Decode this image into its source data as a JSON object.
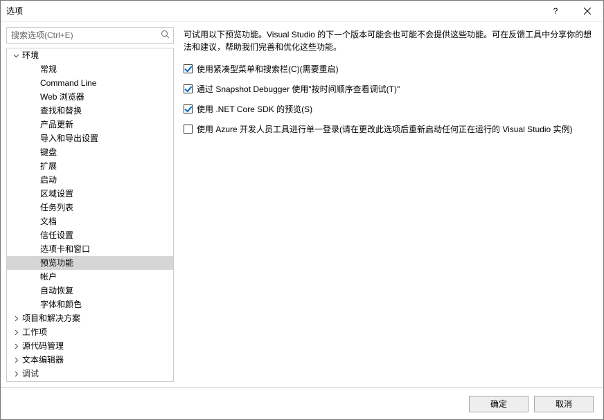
{
  "window": {
    "title": "选项"
  },
  "search": {
    "placeholder": "搜索选项(Ctrl+E)"
  },
  "tree": {
    "items": [
      {
        "label": "环境",
        "level": 0,
        "expanded": true,
        "hasChildren": true,
        "selected": false
      },
      {
        "label": "常规",
        "level": 1,
        "selected": false
      },
      {
        "label": "Command Line",
        "level": 1,
        "selected": false
      },
      {
        "label": "Web 浏览器",
        "level": 1,
        "selected": false
      },
      {
        "label": "查找和替换",
        "level": 1,
        "selected": false
      },
      {
        "label": "产品更新",
        "level": 1,
        "selected": false
      },
      {
        "label": "导入和导出设置",
        "level": 1,
        "selected": false
      },
      {
        "label": "键盘",
        "level": 1,
        "selected": false
      },
      {
        "label": "扩展",
        "level": 1,
        "selected": false
      },
      {
        "label": "启动",
        "level": 1,
        "selected": false
      },
      {
        "label": "区域设置",
        "level": 1,
        "selected": false
      },
      {
        "label": "任务列表",
        "level": 1,
        "selected": false
      },
      {
        "label": "文档",
        "level": 1,
        "selected": false
      },
      {
        "label": "信任设置",
        "level": 1,
        "selected": false
      },
      {
        "label": "选项卡和窗口",
        "level": 1,
        "selected": false
      },
      {
        "label": "预览功能",
        "level": 1,
        "selected": true
      },
      {
        "label": "帐户",
        "level": 1,
        "selected": false
      },
      {
        "label": "自动恢复",
        "level": 1,
        "selected": false
      },
      {
        "label": "字体和颜色",
        "level": 1,
        "selected": false
      },
      {
        "label": "项目和解决方案",
        "level": 0,
        "expanded": false,
        "hasChildren": true,
        "selected": false
      },
      {
        "label": "工作项",
        "level": 0,
        "expanded": false,
        "hasChildren": true,
        "selected": false
      },
      {
        "label": "源代码管理",
        "level": 0,
        "expanded": false,
        "hasChildren": true,
        "selected": false
      },
      {
        "label": "文本编辑器",
        "level": 0,
        "expanded": false,
        "hasChildren": true,
        "selected": false
      },
      {
        "label": "调试",
        "level": 0,
        "expanded": false,
        "hasChildren": true,
        "selected": false,
        "cut": true
      }
    ]
  },
  "main": {
    "description": "可试用以下预览功能。Visual Studio 的下一个版本可能会也可能不会提供这些功能。可在反馈工具中分享你的想法和建议，帮助我们完善和优化这些功能。",
    "options": [
      {
        "label": "使用紧凑型菜单和搜索栏(C)(需要重启)",
        "checked": true
      },
      {
        "label": "通过 Snapshot Debugger 使用\"按时间顺序查看调试(T)\"",
        "checked": true
      },
      {
        "label": "使用 .NET Core SDK 的预览(S)",
        "checked": true
      },
      {
        "label": "使用 Azure 开发人员工具进行单一登录(请在更改此选项后重新启动任何正在运行的 Visual Studio 实例)",
        "checked": false
      }
    ]
  },
  "footer": {
    "ok": "确定",
    "cancel": "取消"
  }
}
